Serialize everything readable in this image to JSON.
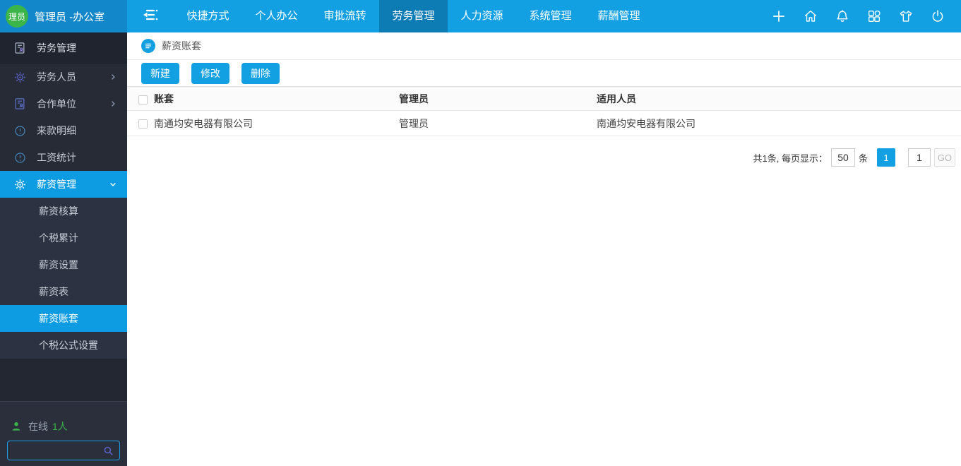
{
  "topbar": {
    "user": {
      "avatar_text": "理员",
      "title": "管理员 -办公室"
    },
    "tabs": [
      {
        "label": "快捷方式",
        "active": false
      },
      {
        "label": "个人办公",
        "active": false
      },
      {
        "label": "审批流转",
        "active": false
      },
      {
        "label": "劳务管理",
        "active": true
      },
      {
        "label": "人力资源",
        "active": false
      },
      {
        "label": "系统管理",
        "active": false
      },
      {
        "label": "薪酬管理",
        "active": false
      }
    ],
    "action_icons": [
      "plus-icon",
      "home-icon",
      "bell-icon",
      "apps-icon",
      "shirt-icon",
      "power-icon"
    ]
  },
  "sidebar": {
    "section_header": {
      "label": "劳务管理",
      "icon": "document-person-icon"
    },
    "items": [
      {
        "label": "劳务人员",
        "icon": "gear-icon",
        "has_children": true
      },
      {
        "label": "合作单位",
        "icon": "document-person-icon",
        "has_children": true
      },
      {
        "label": "来款明细",
        "icon": "info-circle-icon",
        "has_children": false
      },
      {
        "label": "工资统计",
        "icon": "info-circle-icon",
        "has_children": false
      },
      {
        "label": "薪资管理",
        "icon": "gear-icon",
        "expanded": true,
        "active": true
      }
    ],
    "submenu": [
      {
        "label": "薪资核算",
        "active": false
      },
      {
        "label": "个税累计",
        "active": false
      },
      {
        "label": "薪资设置",
        "active": false
      },
      {
        "label": "薪资表",
        "active": false
      },
      {
        "label": "薪资账套",
        "active": true
      },
      {
        "label": "个税公式设置",
        "active": false
      }
    ],
    "online": {
      "icon": "person-icon",
      "label": "在线",
      "count": "1人"
    },
    "search": {
      "value": "",
      "icon": "search-icon"
    }
  },
  "main": {
    "breadcrumb": {
      "icon": "list-circle-icon",
      "label": "薪资账套"
    },
    "toolbar": {
      "new_label": "新建",
      "edit_label": "修改",
      "delete_label": "删除"
    },
    "table": {
      "columns": [
        "账套",
        "管理员",
        "适用人员"
      ],
      "rows": [
        [
          "南通均安电器有限公司",
          "管理员",
          "南通均安电器有限公司"
        ]
      ]
    },
    "pagination": {
      "summary": "共1条, 每页显示：",
      "page_size": "50",
      "unit": "条",
      "current_page": "1",
      "goto_value": "1",
      "go_label": "GO"
    }
  },
  "colors": {
    "topbar": "#12a0e3",
    "topbar_left": "#1287c9",
    "active_tab": "#0d7cb5",
    "sidebar_bg": "#262b36",
    "submenu_bg": "#2d3242",
    "active_item": "#0d9ce2",
    "accent_green": "#3bb54a",
    "icon_purple": "#5c61c9",
    "icon_blue": "#4583b5"
  }
}
